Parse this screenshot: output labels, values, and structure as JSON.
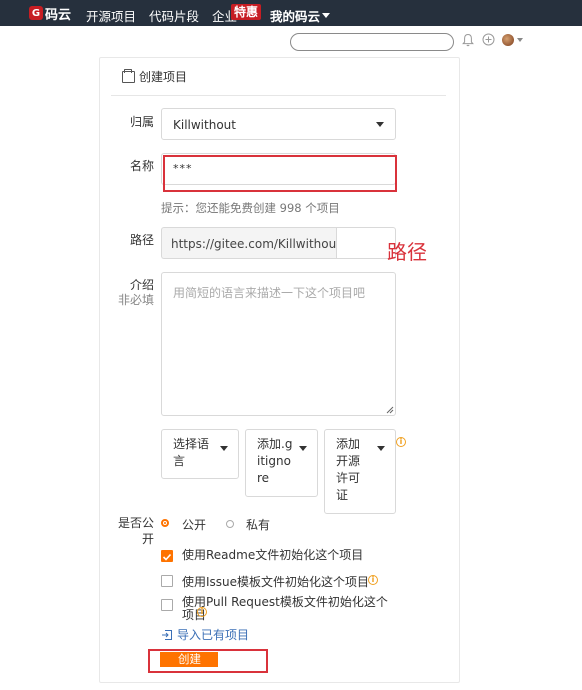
{
  "topnav": {
    "logo_mark": "G",
    "logo_text": "码云",
    "items": [
      "开源项目",
      "代码片段",
      "企业"
    ],
    "badge": "特惠",
    "mine": "我的码云"
  },
  "header_icons": [
    "bell-icon",
    "plus-icon",
    "avatar"
  ],
  "panel": {
    "title": "创建项目"
  },
  "form": {
    "owner_label": "归属",
    "owner_value": "Killwithout",
    "name_label": "名称",
    "name_value": "***",
    "name_hint": "提示：您还能免费创建 998 个项目",
    "path_label": "路径",
    "path_prefix": "https://gitee.com/Killwithout/",
    "path_annotation": "路径",
    "desc_label": "介绍",
    "desc_optional": "非必填",
    "desc_placeholder": "用简短的语言来描述一下这个项目吧",
    "lang_select": "选择语言",
    "gitignore_select": "添加.gitignore",
    "license_select": "添加开源许可证",
    "visibility_label": "是否公开",
    "public_label": "公开",
    "private_label": "私有",
    "visibility_selected": "公开",
    "readme_label": "使用Readme文件初始化这个项目",
    "readme_checked": true,
    "issue_label": "使用Issue模板文件初始化这个项目",
    "issue_checked": false,
    "pr_label": "使用Pull Request模板文件初始化这个项目",
    "pr_checked": false,
    "import_label": "导入已有项目",
    "create_label": "创建"
  },
  "colors": {
    "accent": "#fe7300",
    "annotation": "#d9323b",
    "topbar": "#26303d",
    "brand": "#c71d23"
  }
}
